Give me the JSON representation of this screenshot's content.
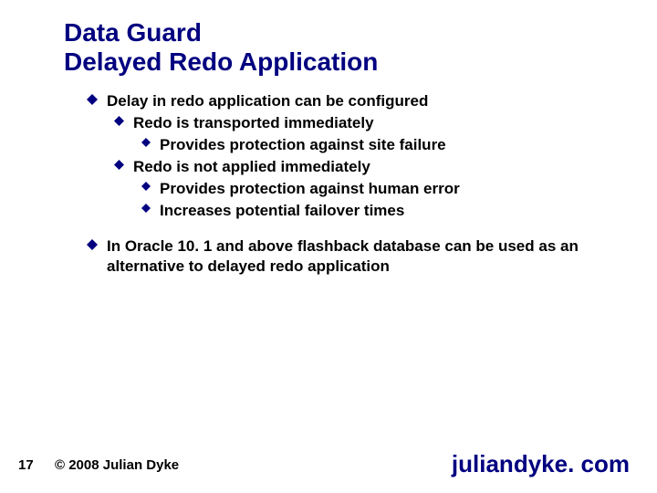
{
  "title_line1": "Data Guard",
  "title_line2": "Delayed Redo Application",
  "bullets": {
    "b1": "Delay in redo application can be configured",
    "b1_1": "Redo is transported immediately",
    "b1_1_1": "Provides protection against site failure",
    "b1_2": "Redo is not applied immediately",
    "b1_2_1": "Provides protection against human error",
    "b1_2_2": "Increases potential failover times",
    "b2": "In Oracle 10. 1 and above flashback database can be used as an alternative to delayed redo application"
  },
  "page_number": "17",
  "copyright": "© 2008 Julian Dyke",
  "site": "juliandyke. com"
}
